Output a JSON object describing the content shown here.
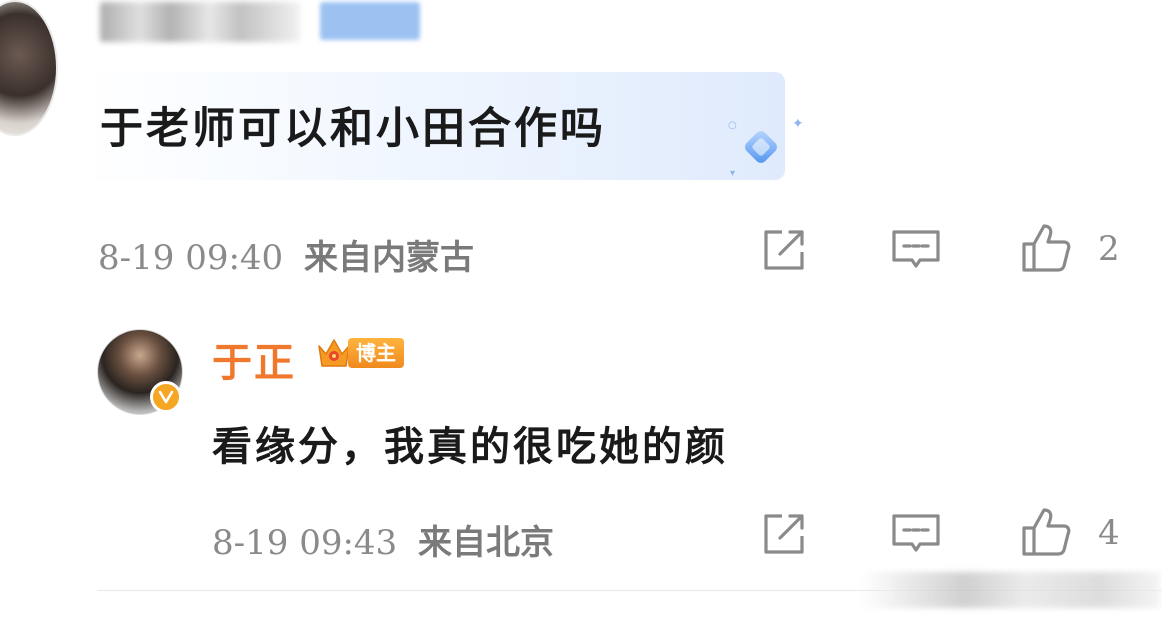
{
  "comment": {
    "text": "于老师可以和小田合作吗",
    "time": "8-19 09:40",
    "location": "来自内蒙古",
    "like_count": "2",
    "icons": [
      "share-icon",
      "reply-icon",
      "like-icon"
    ]
  },
  "reply": {
    "author": "于正",
    "badge": "博主",
    "text": "看缘分，我真的很吃她的颜",
    "time": "8-19 09:43",
    "location": "来自北京",
    "like_count": "4",
    "icons": [
      "share-icon",
      "reply-icon",
      "like-icon"
    ]
  },
  "colors": {
    "author_name": "#f0782d",
    "badge_bg": "#f5a623",
    "meta_text": "#8a8a8a",
    "bubble": "#dfeafc"
  }
}
